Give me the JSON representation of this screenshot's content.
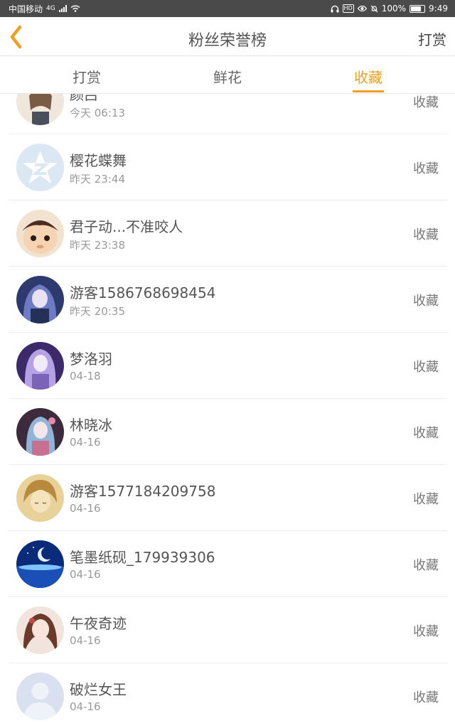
{
  "status_bar": {
    "carrier": "中国移动",
    "network": "4G",
    "battery": "100%",
    "time": "9:49"
  },
  "header": {
    "title": "粉丝荣誉榜",
    "action_label": "打赏",
    "accent_color": "#f0a01e"
  },
  "tabs": [
    {
      "label": "打赏",
      "active": false
    },
    {
      "label": "鲜花",
      "active": false
    },
    {
      "label": "收藏",
      "active": true
    }
  ],
  "fans": [
    {
      "name": "颜吕",
      "time": "今天 06:13",
      "type": "收藏",
      "avatar": "anime-girl-avatar"
    },
    {
      "name": "樱花蝶舞",
      "time": "昨天 23:44",
      "type": "收藏",
      "avatar": "qq-default-avatar"
    },
    {
      "name": "君子动...不准咬人",
      "time": "昨天 23:38",
      "type": "收藏",
      "avatar": "doll-avatar"
    },
    {
      "name": "游客1586768698454",
      "time": "昨天 20:35",
      "type": "收藏",
      "avatar": "anime-girl-avatar"
    },
    {
      "name": "梦洛羽",
      "time": "04-18",
      "type": "收藏",
      "avatar": "anime-girl-avatar"
    },
    {
      "name": "林晓冰",
      "time": "04-16",
      "type": "收藏",
      "avatar": "anime-girl-avatar"
    },
    {
      "name": "游客1577184209758",
      "time": "04-16",
      "type": "收藏",
      "avatar": "anime-boy-avatar"
    },
    {
      "name": "笔墨纸砚_179939306",
      "time": "04-16",
      "type": "收藏",
      "avatar": "moon-night-avatar"
    },
    {
      "name": "午夜奇迹",
      "time": "04-16",
      "type": "收藏",
      "avatar": "anime-girl-avatar"
    },
    {
      "name": "破烂女王",
      "time": "04-16",
      "type": "收藏",
      "avatar": "default-person-avatar"
    }
  ]
}
